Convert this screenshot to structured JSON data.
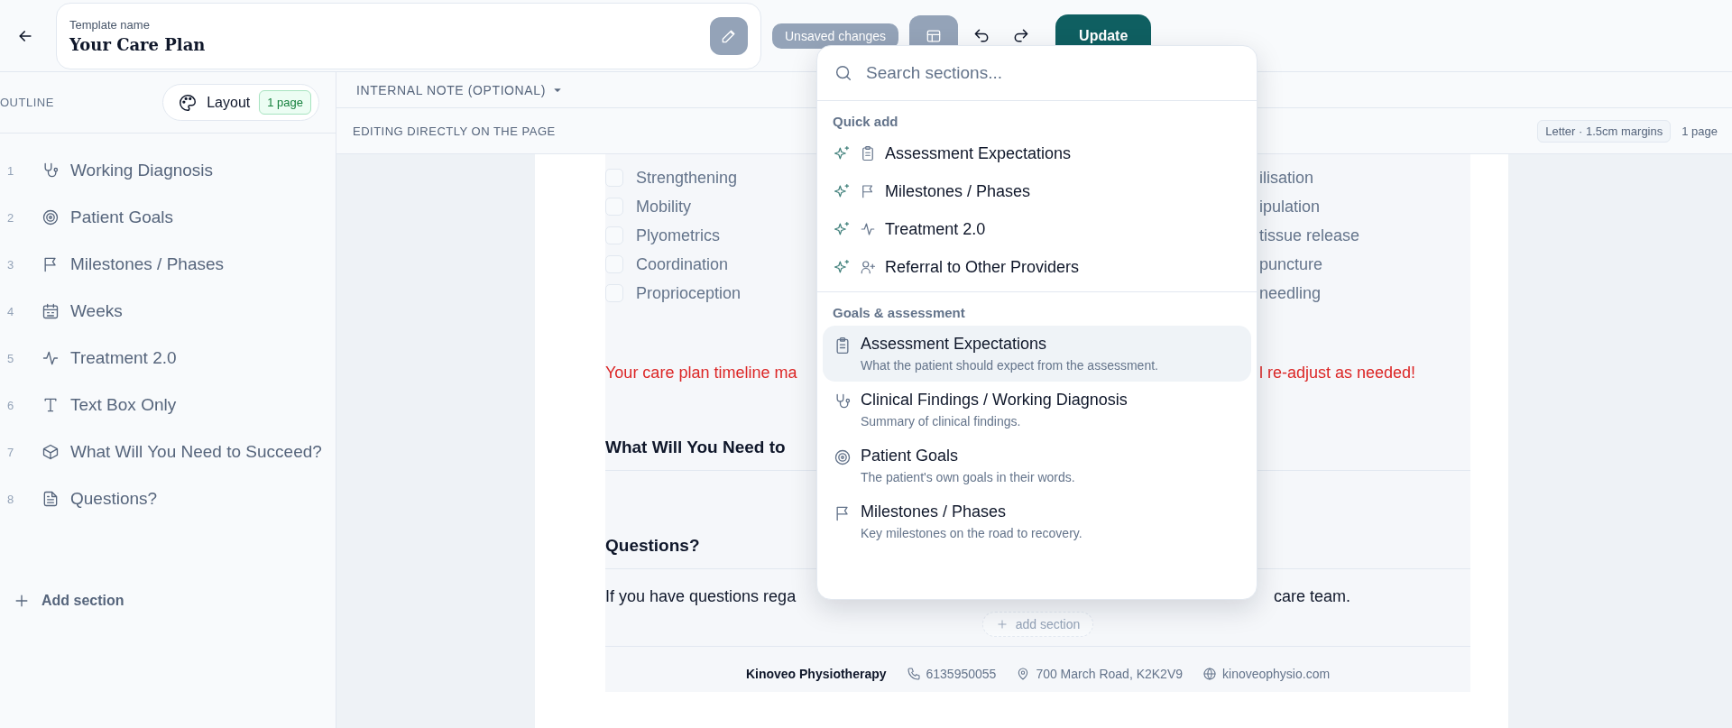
{
  "header": {
    "template_name": {
      "label": "Template name",
      "value": "Your Care Plan"
    },
    "status_badge": "Unsaved changes",
    "update_button": "Update"
  },
  "sidebar": {
    "title": "OUTLINE",
    "layout_button": {
      "label": "Layout",
      "badge": "1 page"
    },
    "items": [
      {
        "number": "1",
        "kind": "diagnosis",
        "label": "Working Diagnosis"
      },
      {
        "number": "2",
        "kind": "goals",
        "label": "Patient Goals"
      },
      {
        "number": "3",
        "kind": "milestones",
        "label": "Milestones / Phases"
      },
      {
        "number": "4",
        "kind": "weeks",
        "label": "Weeks"
      },
      {
        "number": "5",
        "kind": "treatment",
        "label": "Treatment 2.0"
      },
      {
        "number": "6",
        "kind": "text",
        "label": "Text Box Only"
      },
      {
        "number": "7",
        "kind": "needs",
        "label": "What Will You Need to Succeed?"
      },
      {
        "number": "8",
        "kind": "questions",
        "label": "Questions?"
      }
    ],
    "add_section": "Add section"
  },
  "toolbar": {
    "internal_note": "INTERNAL NOTE (OPTIONAL)",
    "mode": "EDITING DIRECTLY ON THE PAGE",
    "page_format": "Letter · 1.5cm margins",
    "page_count": "1 page"
  },
  "document": {
    "checklist_left": [
      {
        "label": "Strengthening",
        "checked": false
      },
      {
        "label": "Mobility",
        "checked": false
      },
      {
        "label": "Plyometrics",
        "checked": false
      },
      {
        "label": "Coordination",
        "checked": false
      },
      {
        "label": "Proprioception",
        "checked": false
      }
    ],
    "checklist_right": [
      "ilisation",
      "ipulation",
      "tissue release",
      "puncture",
      "needling"
    ],
    "notice_parts": [
      "Your care plan timeline ma",
      "l re-adjust as needed!"
    ],
    "sections": [
      {
        "heading": "What Will You Need to"
      },
      {
        "heading": "Questions?",
        "body_parts": [
          "If you have questions rega",
          "care team."
        ]
      }
    ],
    "add_section": "add section",
    "footer": {
      "clinic": "Kinoveo Physiotherapy",
      "phone": "6135950055",
      "address": "700 March Road, K2K2V9",
      "website": "kinoveophysio.com"
    }
  },
  "section_picker": {
    "search_placeholder": "Search sections...",
    "quick_add": {
      "title": "Quick add",
      "items": [
        {
          "kind": "assessment",
          "label": "Assessment Expectations"
        },
        {
          "kind": "milestones",
          "label": "Milestones / Phases"
        },
        {
          "kind": "treatment",
          "label": "Treatment 2.0"
        },
        {
          "kind": "referral",
          "label": "Referral to Other Providers"
        }
      ]
    },
    "groups": [
      {
        "title": "Goals & assessment",
        "items": [
          {
            "kind": "assessment",
            "title": "Assessment Expectations",
            "description": "What the patient should expect from the assessment.",
            "selected": true
          },
          {
            "kind": "diagnosis",
            "title": "Clinical Findings / Working Diagnosis",
            "description": "Summary of clinical findings.",
            "selected": false
          },
          {
            "kind": "goals",
            "title": "Patient Goals",
            "description": "The patient's own goals in their words.",
            "selected": false
          },
          {
            "kind": "milestones",
            "title": "Milestones / Phases",
            "description": "Key milestones on the road to recovery.",
            "selected": false
          }
        ]
      }
    ]
  }
}
